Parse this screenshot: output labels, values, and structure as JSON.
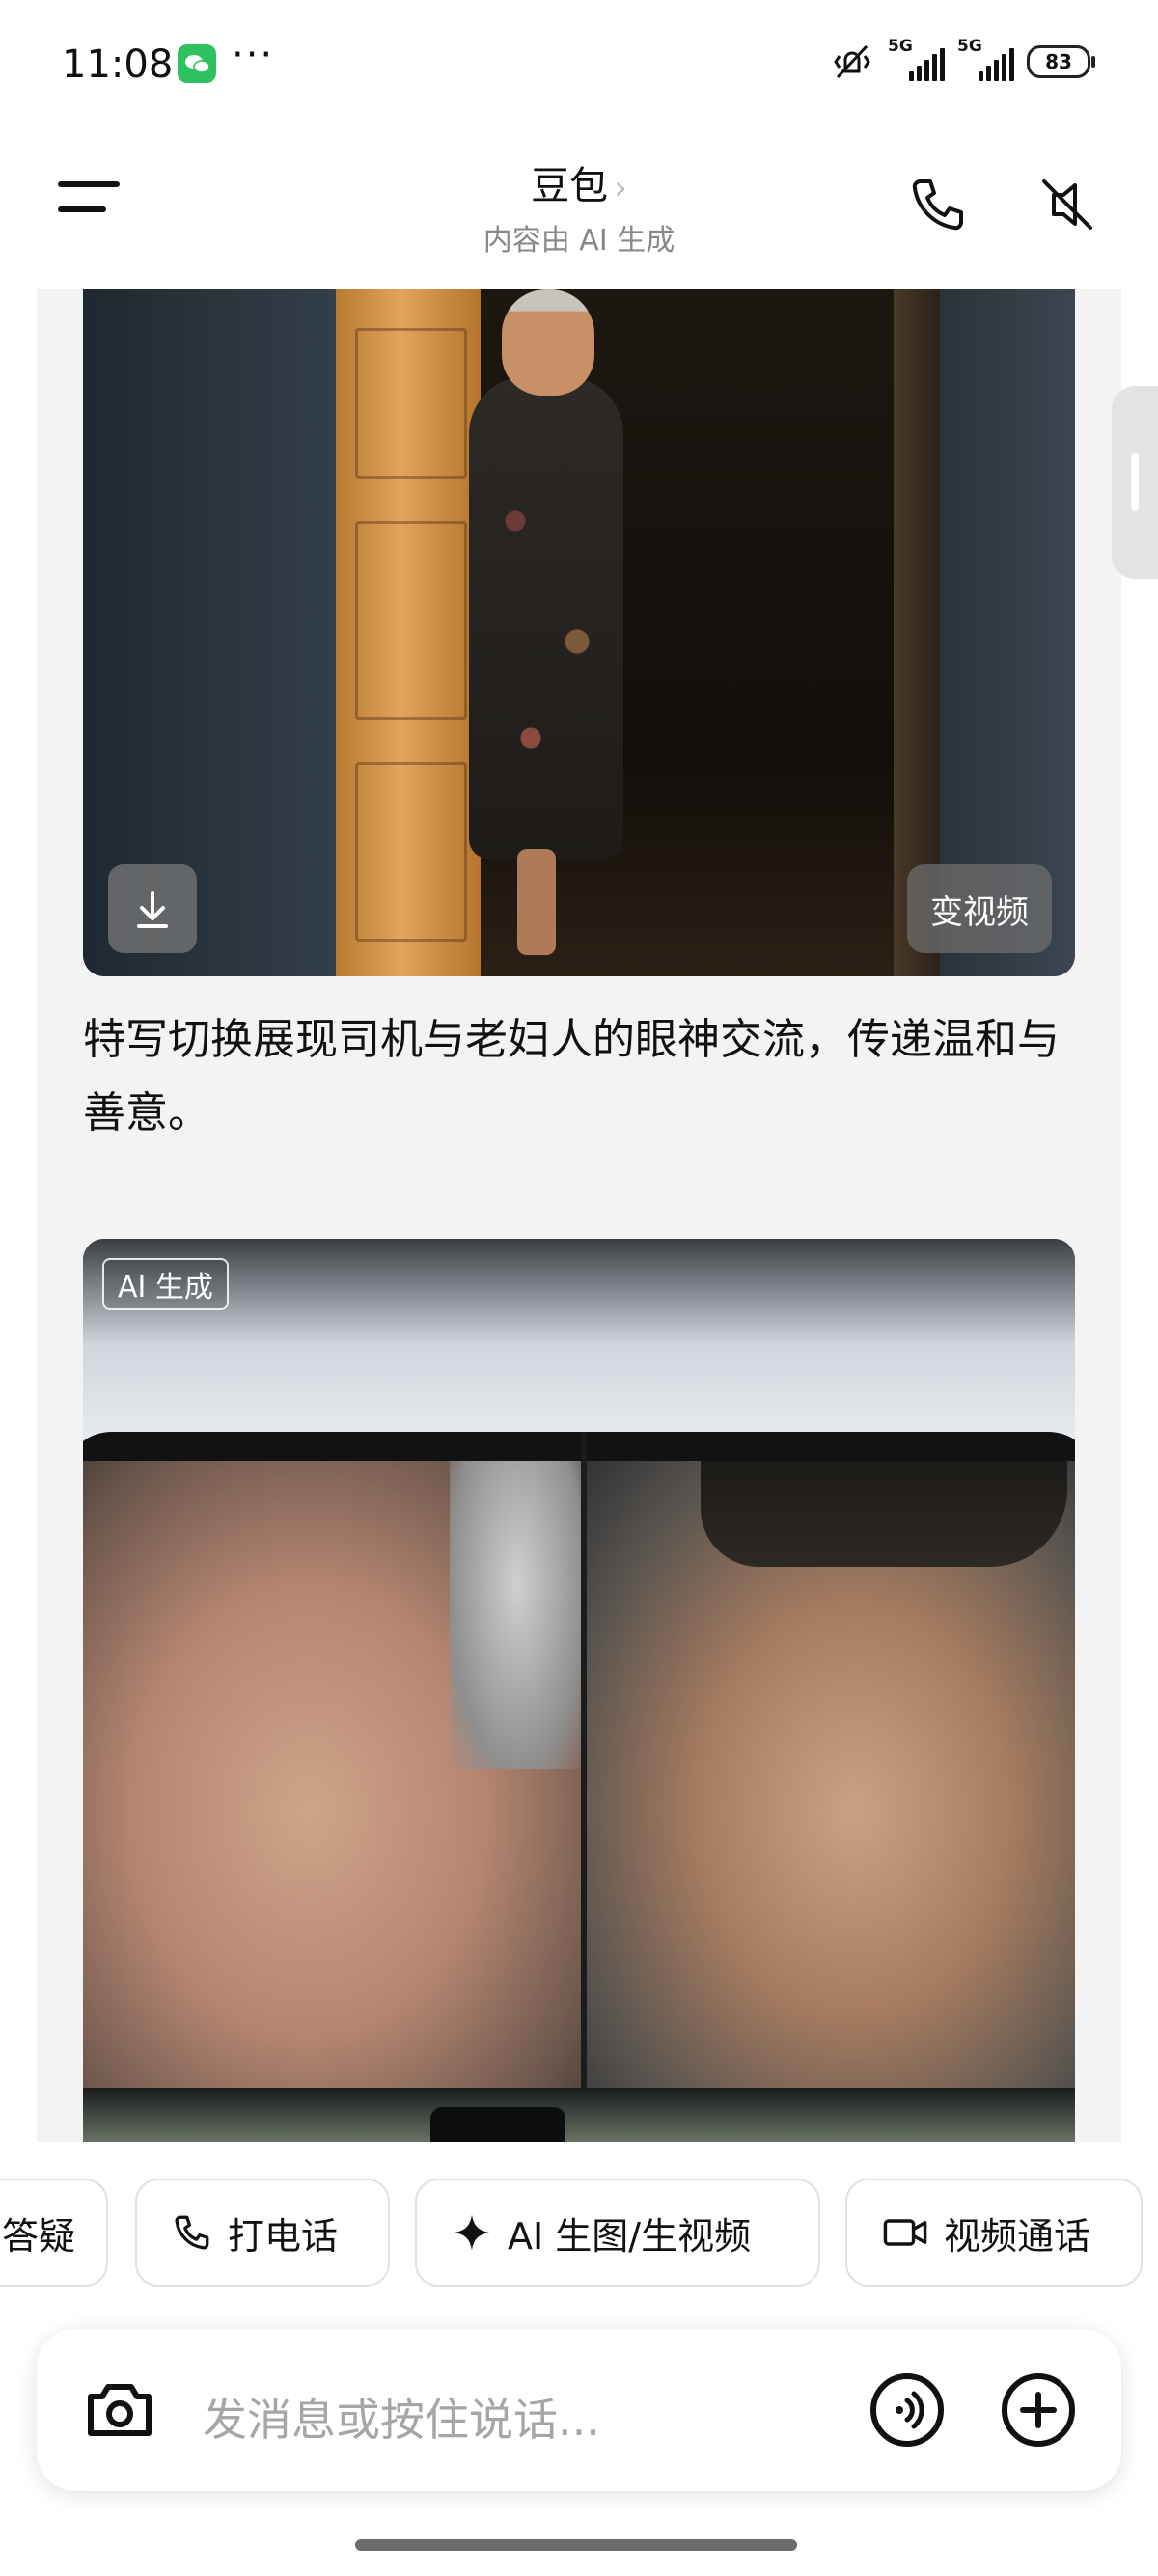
{
  "status_bar": {
    "time": "11:08",
    "dots": "···",
    "network1": "5G",
    "network2": "5G",
    "battery": "83"
  },
  "header": {
    "title": "豆包",
    "chevron": "›",
    "subtitle": "内容由 AI 生成"
  },
  "chat": {
    "image1": {
      "action_label": "变视频"
    },
    "caption": "特写切换展现司机与老妇人的眼神交流，传递温和与善意。",
    "image2": {
      "badge": "AI 生成"
    }
  },
  "chips": [
    {
      "label": "答疑",
      "icon": ""
    },
    {
      "label": "打电话",
      "icon": "phone-icon"
    },
    {
      "label": "AI 生图/生视频",
      "icon": "sparkle-icon"
    },
    {
      "label": "视频通话",
      "icon": "video-camera-icon"
    }
  ],
  "input": {
    "placeholder": "发消息或按住说话..."
  },
  "colors": {
    "chat_background": "#f3f3f3",
    "wechat_green": "#2dc15f",
    "placeholder_gray": "#a6a6a6"
  }
}
